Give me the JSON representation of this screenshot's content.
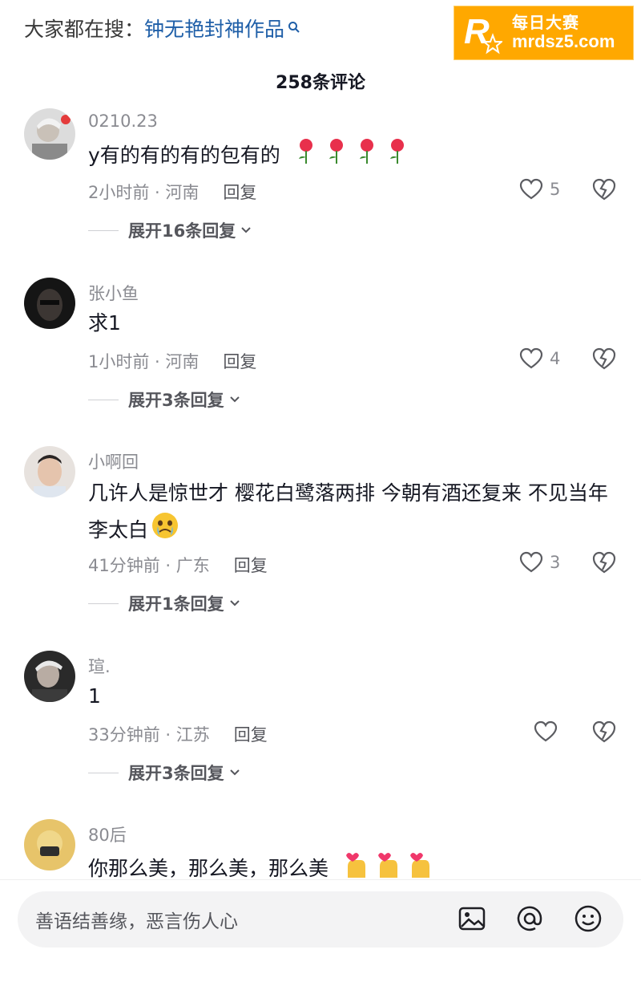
{
  "search_bar": {
    "prefix": "大家都在搜：",
    "query": "钟无艳封神作品"
  },
  "watermark": {
    "logo_letter": "R",
    "logo_small": "每日大赛",
    "cn": "每日大赛",
    "en": "mrdsz5.com",
    "color": "#ffa800"
  },
  "comment_count": "258条评论",
  "comments": [
    {
      "name": "0210.23",
      "text": "y有的有的有的包有的",
      "emoji": "rose x4",
      "time": "2小时前 · 河南",
      "reply": "回复",
      "likes": "5",
      "expand": "展开16条回复"
    },
    {
      "name": "张小鱼",
      "text": "求1",
      "time": "1小时前 · 河南",
      "reply": "回复",
      "likes": "4",
      "expand": "展开3条回复"
    },
    {
      "name": "小啊回",
      "text": "几许人是惊世才 樱花白鹭落两排 今朝有酒还复来 不见当年李太白",
      "emoji": "crying-face",
      "time": "41分钟前 · 广东",
      "reply": "回复",
      "likes": "3",
      "expand": "展开1条回复"
    },
    {
      "name": "瑄.",
      "text": "1",
      "time": "33分钟前 · 江苏",
      "reply": "回复",
      "likes": "",
      "expand": "展开3条回复"
    },
    {
      "name": "80后",
      "text": "你那么美，那么美，那么美",
      "emoji": "finger-heart x3"
    }
  ],
  "input": {
    "placeholder": "善语结善缘，恶言伤人心"
  },
  "icons": {
    "image": "image-icon",
    "mention": "at-icon",
    "emoji": "emoji-icon",
    "like": "heart-outline-icon",
    "dislike": "broken-heart-icon"
  }
}
